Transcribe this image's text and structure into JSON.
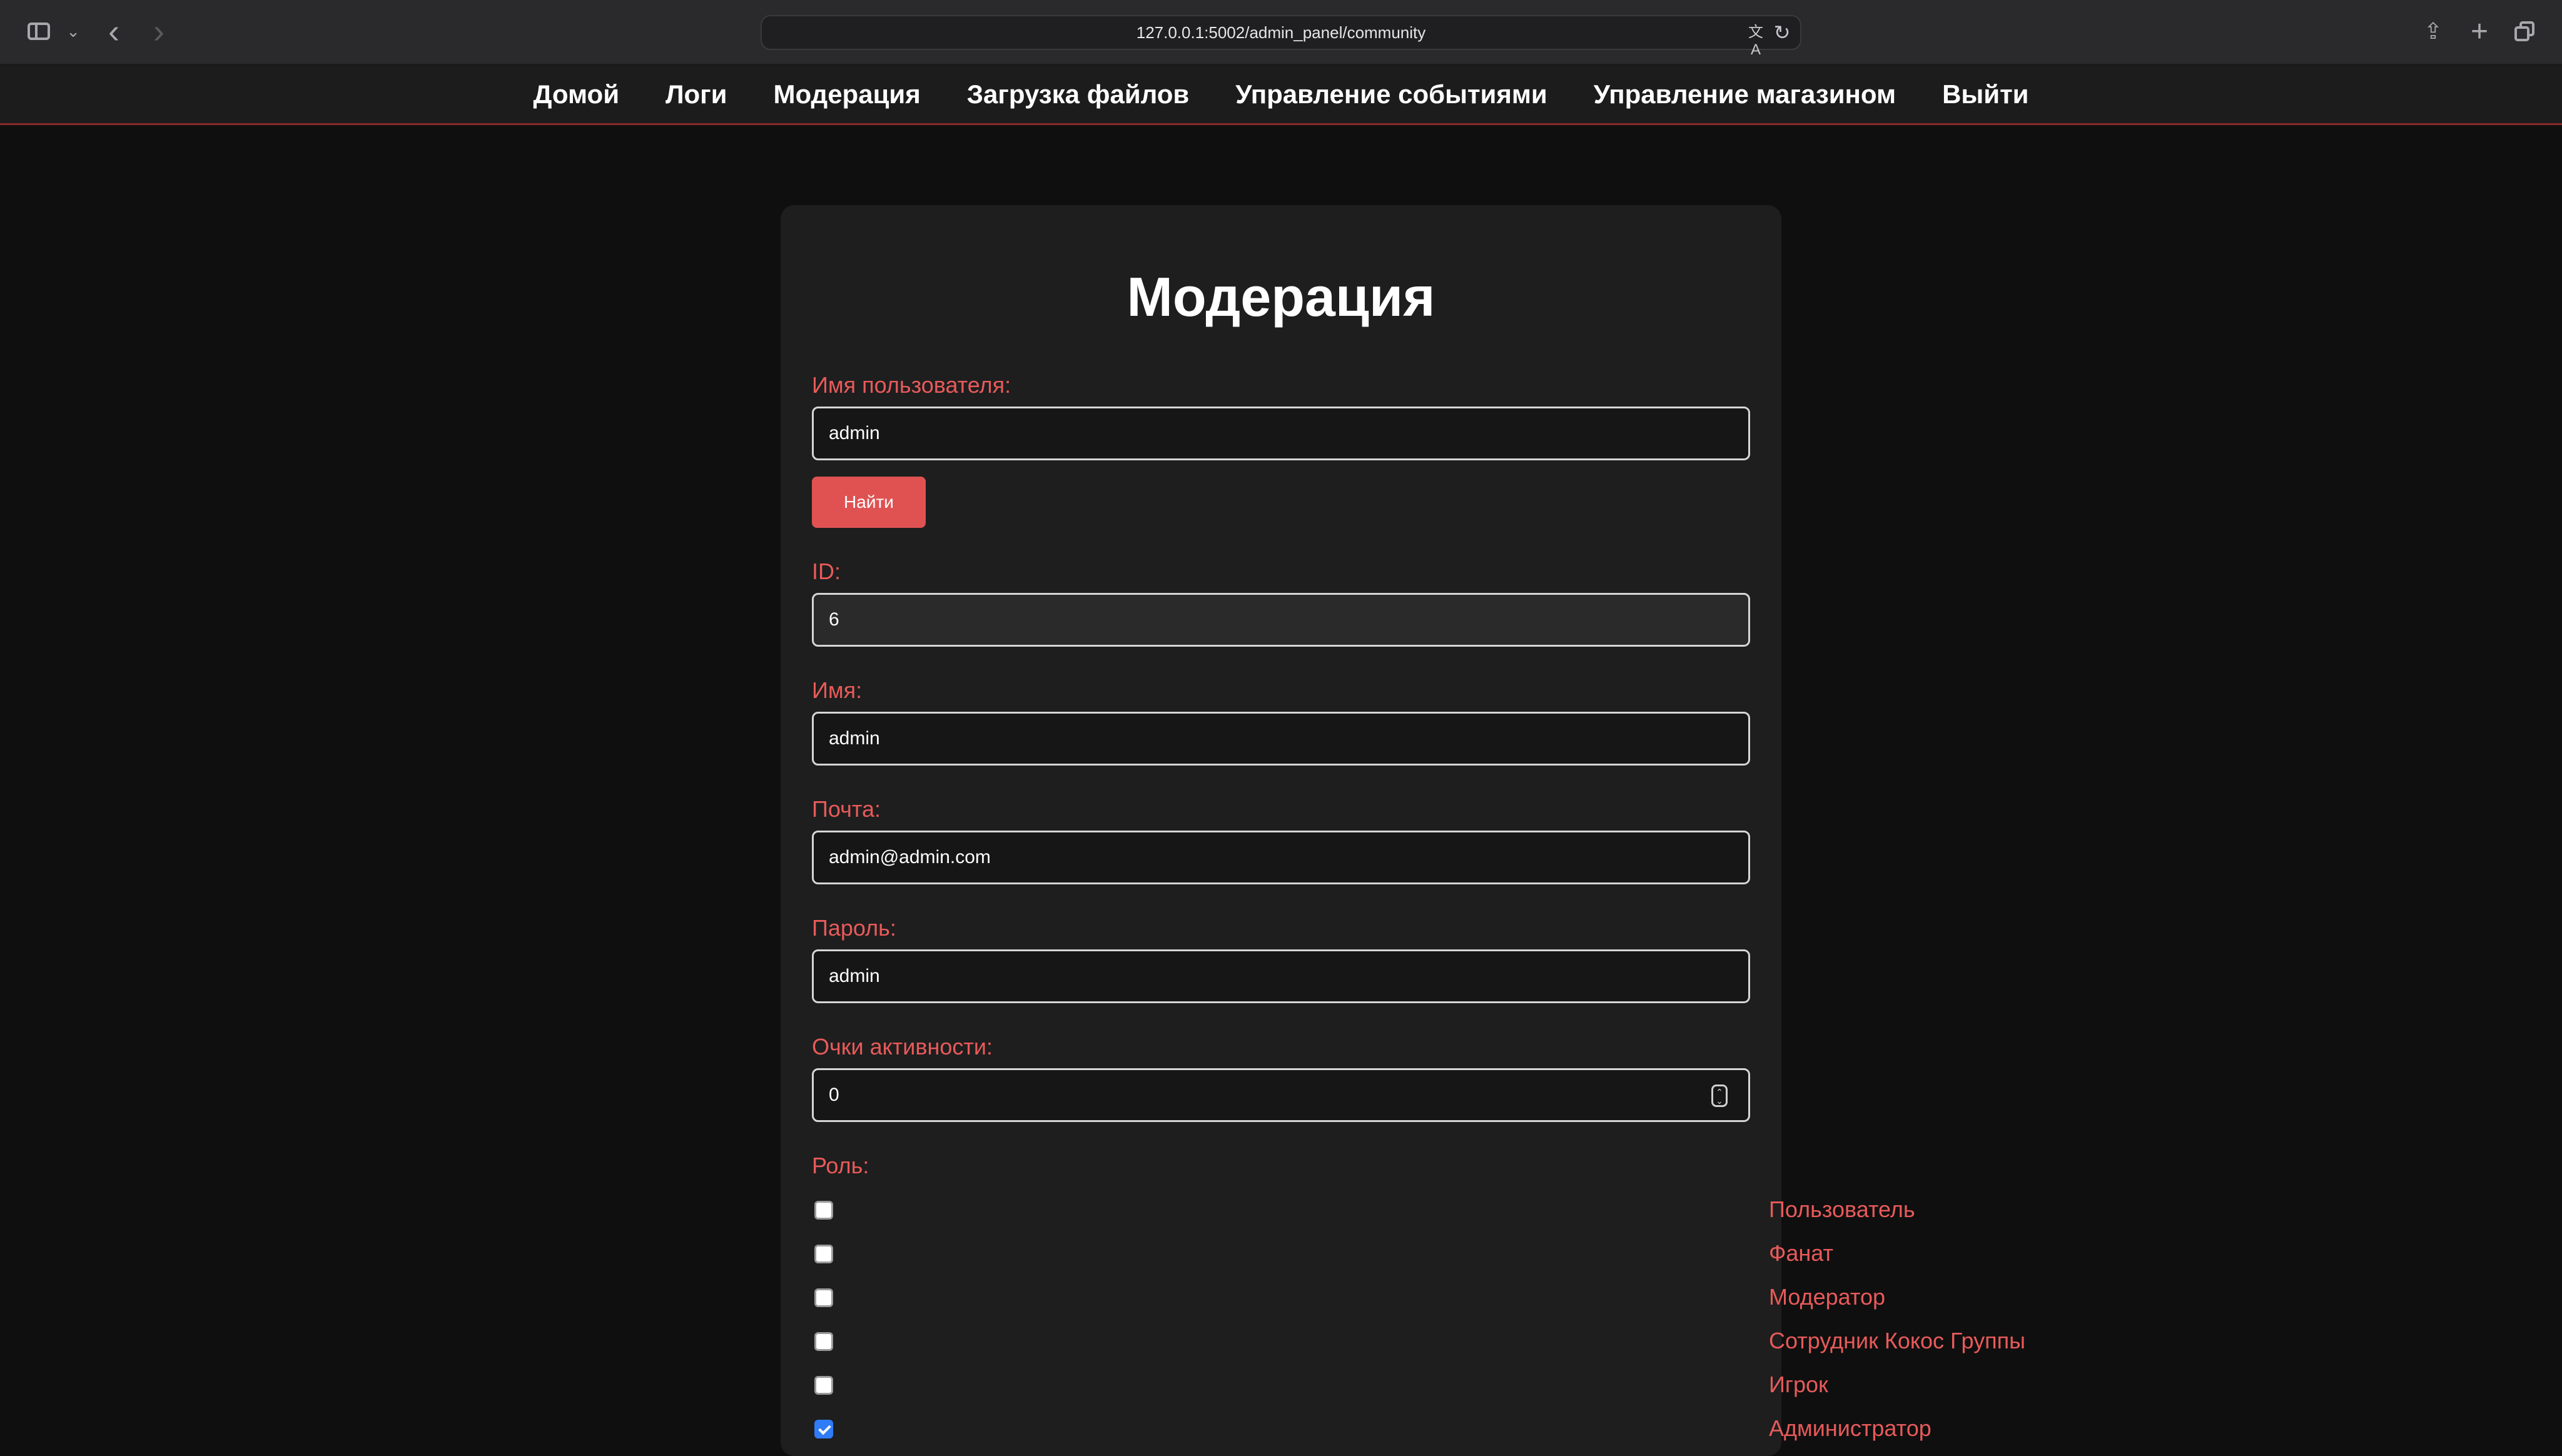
{
  "browser": {
    "url": "127.0.0.1:5002/admin_panel/community"
  },
  "nav": {
    "items": [
      "Домой",
      "Логи",
      "Модерация",
      "Загрузка файлов",
      "Управление событиями",
      "Управление магазином",
      "Выйти"
    ]
  },
  "form": {
    "title": "Модерация",
    "username_label": "Имя пользователя:",
    "username_value": "admin",
    "find_button": "Найти",
    "id_label": "ID:",
    "id_value": "6",
    "name_label": "Имя:",
    "name_value": "admin",
    "email_label": "Почта:",
    "email_value": "admin@admin.com",
    "password_label": "Пароль:",
    "password_value": "admin",
    "points_label": "Очки активности:",
    "points_value": "0",
    "role_label": "Роль:",
    "roles": [
      {
        "label": "Пользователь",
        "checked": false
      },
      {
        "label": "Фанат",
        "checked": false
      },
      {
        "label": "Модератор",
        "checked": false
      },
      {
        "label": "Сотрудник Кокос Группы",
        "checked": false
      },
      {
        "label": "Игрок",
        "checked": false
      },
      {
        "label": "Администратор",
        "checked": true
      }
    ]
  },
  "colors": {
    "accent": "#e05252",
    "label": "#e85a5a",
    "background": "#0f0f0f",
    "card": "#1e1e1e",
    "checkbox_checked": "#2f7cf6"
  }
}
